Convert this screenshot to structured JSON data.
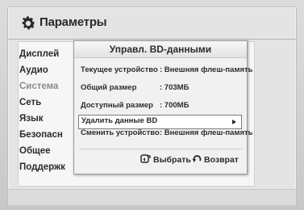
{
  "header": {
    "title": "Параметры",
    "icon": "gear-icon"
  },
  "menu": {
    "items": [
      {
        "label": "Дисплей",
        "dimmed": false
      },
      {
        "label": "Аудио",
        "dimmed": false
      },
      {
        "label": "Система",
        "dimmed": true
      },
      {
        "label": "Сеть",
        "dimmed": false
      },
      {
        "label": "Язык",
        "dimmed": false
      },
      {
        "label": "Безопасн",
        "dimmed": false
      },
      {
        "label": "Общее",
        "dimmed": false
      },
      {
        "label": "Поддержк",
        "dimmed": false
      }
    ]
  },
  "dialog": {
    "title": "Управл. BD-данными",
    "rows": [
      {
        "label": "Текущее устройство",
        "value": ": Внешняя флеш-память"
      },
      {
        "label": "Общий размер",
        "value": ": 703МБ"
      },
      {
        "label": "Доступный размер",
        "value": ": 700МБ"
      },
      {
        "label": "Удалить данные BD",
        "value": ""
      },
      {
        "label": "Сменить устройство",
        "value": ": Внешняя флеш-память"
      }
    ],
    "footer": {
      "select_label": "Выбрать",
      "select_icon": "enter-icon",
      "back_label": "Возврат",
      "back_icon": "return-icon"
    }
  },
  "colors": {
    "background": "#d0d0d0",
    "panel": "#e4e4e4",
    "dialog": "#f1f1f1",
    "text": "#2b2b2b"
  }
}
